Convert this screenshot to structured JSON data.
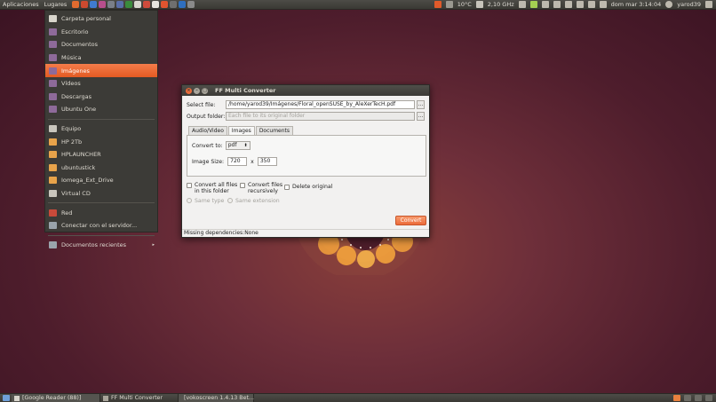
{
  "top_panel": {
    "applications": "Aplicaciones",
    "places": "Lugares",
    "temperature": "10°C",
    "cpu_freq": "2,10 GHz",
    "datetime": "dom mar  3:14:04",
    "user": "yarod39"
  },
  "places_menu": {
    "items": [
      {
        "label": "Carpeta personal",
        "icon": "home-folder-icon",
        "color": "#d8d5cc"
      },
      {
        "label": "Escritorio",
        "icon": "desktop-folder-icon",
        "color": "#8e6a9a"
      },
      {
        "label": "Documentos",
        "icon": "documents-folder-icon",
        "color": "#8e6a9a"
      },
      {
        "label": "Música",
        "icon": "music-folder-icon",
        "color": "#8e6a9a"
      },
      {
        "label": "Imágenes",
        "icon": "pictures-folder-icon",
        "color": "#8e6a9a"
      },
      {
        "label": "Vídeos",
        "icon": "videos-folder-icon",
        "color": "#8e6a9a"
      },
      {
        "label": "Descargas",
        "icon": "downloads-folder-icon",
        "color": "#8e6a9a"
      },
      {
        "label": "Ubuntu One",
        "icon": "ubuntu-one-folder-icon",
        "color": "#8e6a9a"
      },
      {
        "label": "Equipo",
        "icon": "computer-icon",
        "color": "#c9c6bd"
      },
      {
        "label": "HP 2Tb",
        "icon": "drive-icon",
        "color": "#e8a34a"
      },
      {
        "label": "HPLAUNCHER",
        "icon": "drive-icon",
        "color": "#e8a34a"
      },
      {
        "label": "ubuntustick",
        "icon": "drive-icon",
        "color": "#e8a34a"
      },
      {
        "label": "Iomega_Ext_Drive",
        "icon": "drive-icon",
        "color": "#e8a34a"
      },
      {
        "label": "Virtual CD",
        "icon": "cd-icon",
        "color": "#c9c6bd"
      },
      {
        "label": "Red",
        "icon": "network-icon",
        "color": "#c94a3a"
      },
      {
        "label": "Conectar con el servidor...",
        "icon": "connect-server-icon",
        "color": "#9aa3ab"
      },
      {
        "label": "Documentos recientes",
        "icon": "recent-documents-icon",
        "color": "#9aa3ab"
      }
    ],
    "active_index": 4
  },
  "window": {
    "title": "FF Multi Converter",
    "select_file_label": "Select file:",
    "select_file_value": "/home/yarod39/Imágenes/Floral_openSUSE_by_AleXerTecH.pdf",
    "browse_label": "...",
    "output_folder_label": "Output folder:",
    "output_folder_placeholder": "Each file to its original folder",
    "tabs": [
      "Audio/Video",
      "Images",
      "Documents"
    ],
    "active_tab": 1,
    "convert_to_label": "Convert to:",
    "convert_to_value": "pdf",
    "image_size_label": "Image Size:",
    "width": "720",
    "height": "350",
    "size_separator": "x",
    "convert_all_label": "Convert all files in this folder",
    "convert_recursive_label": "Convert files recursively",
    "delete_original_label": "Delete original",
    "same_type_label": "Same type",
    "same_extension_label": "Same extension",
    "convert_button": "Convert",
    "status": "Missing dependencies:None"
  },
  "bottom_panel": {
    "tasks": [
      "[Google Reader (88)]",
      "FF Multi Converter",
      "[vokoscreen 1.4.13 Bet..."
    ]
  },
  "colors": {
    "accent": "#ec6b3a",
    "panel": "#3c3b37"
  }
}
